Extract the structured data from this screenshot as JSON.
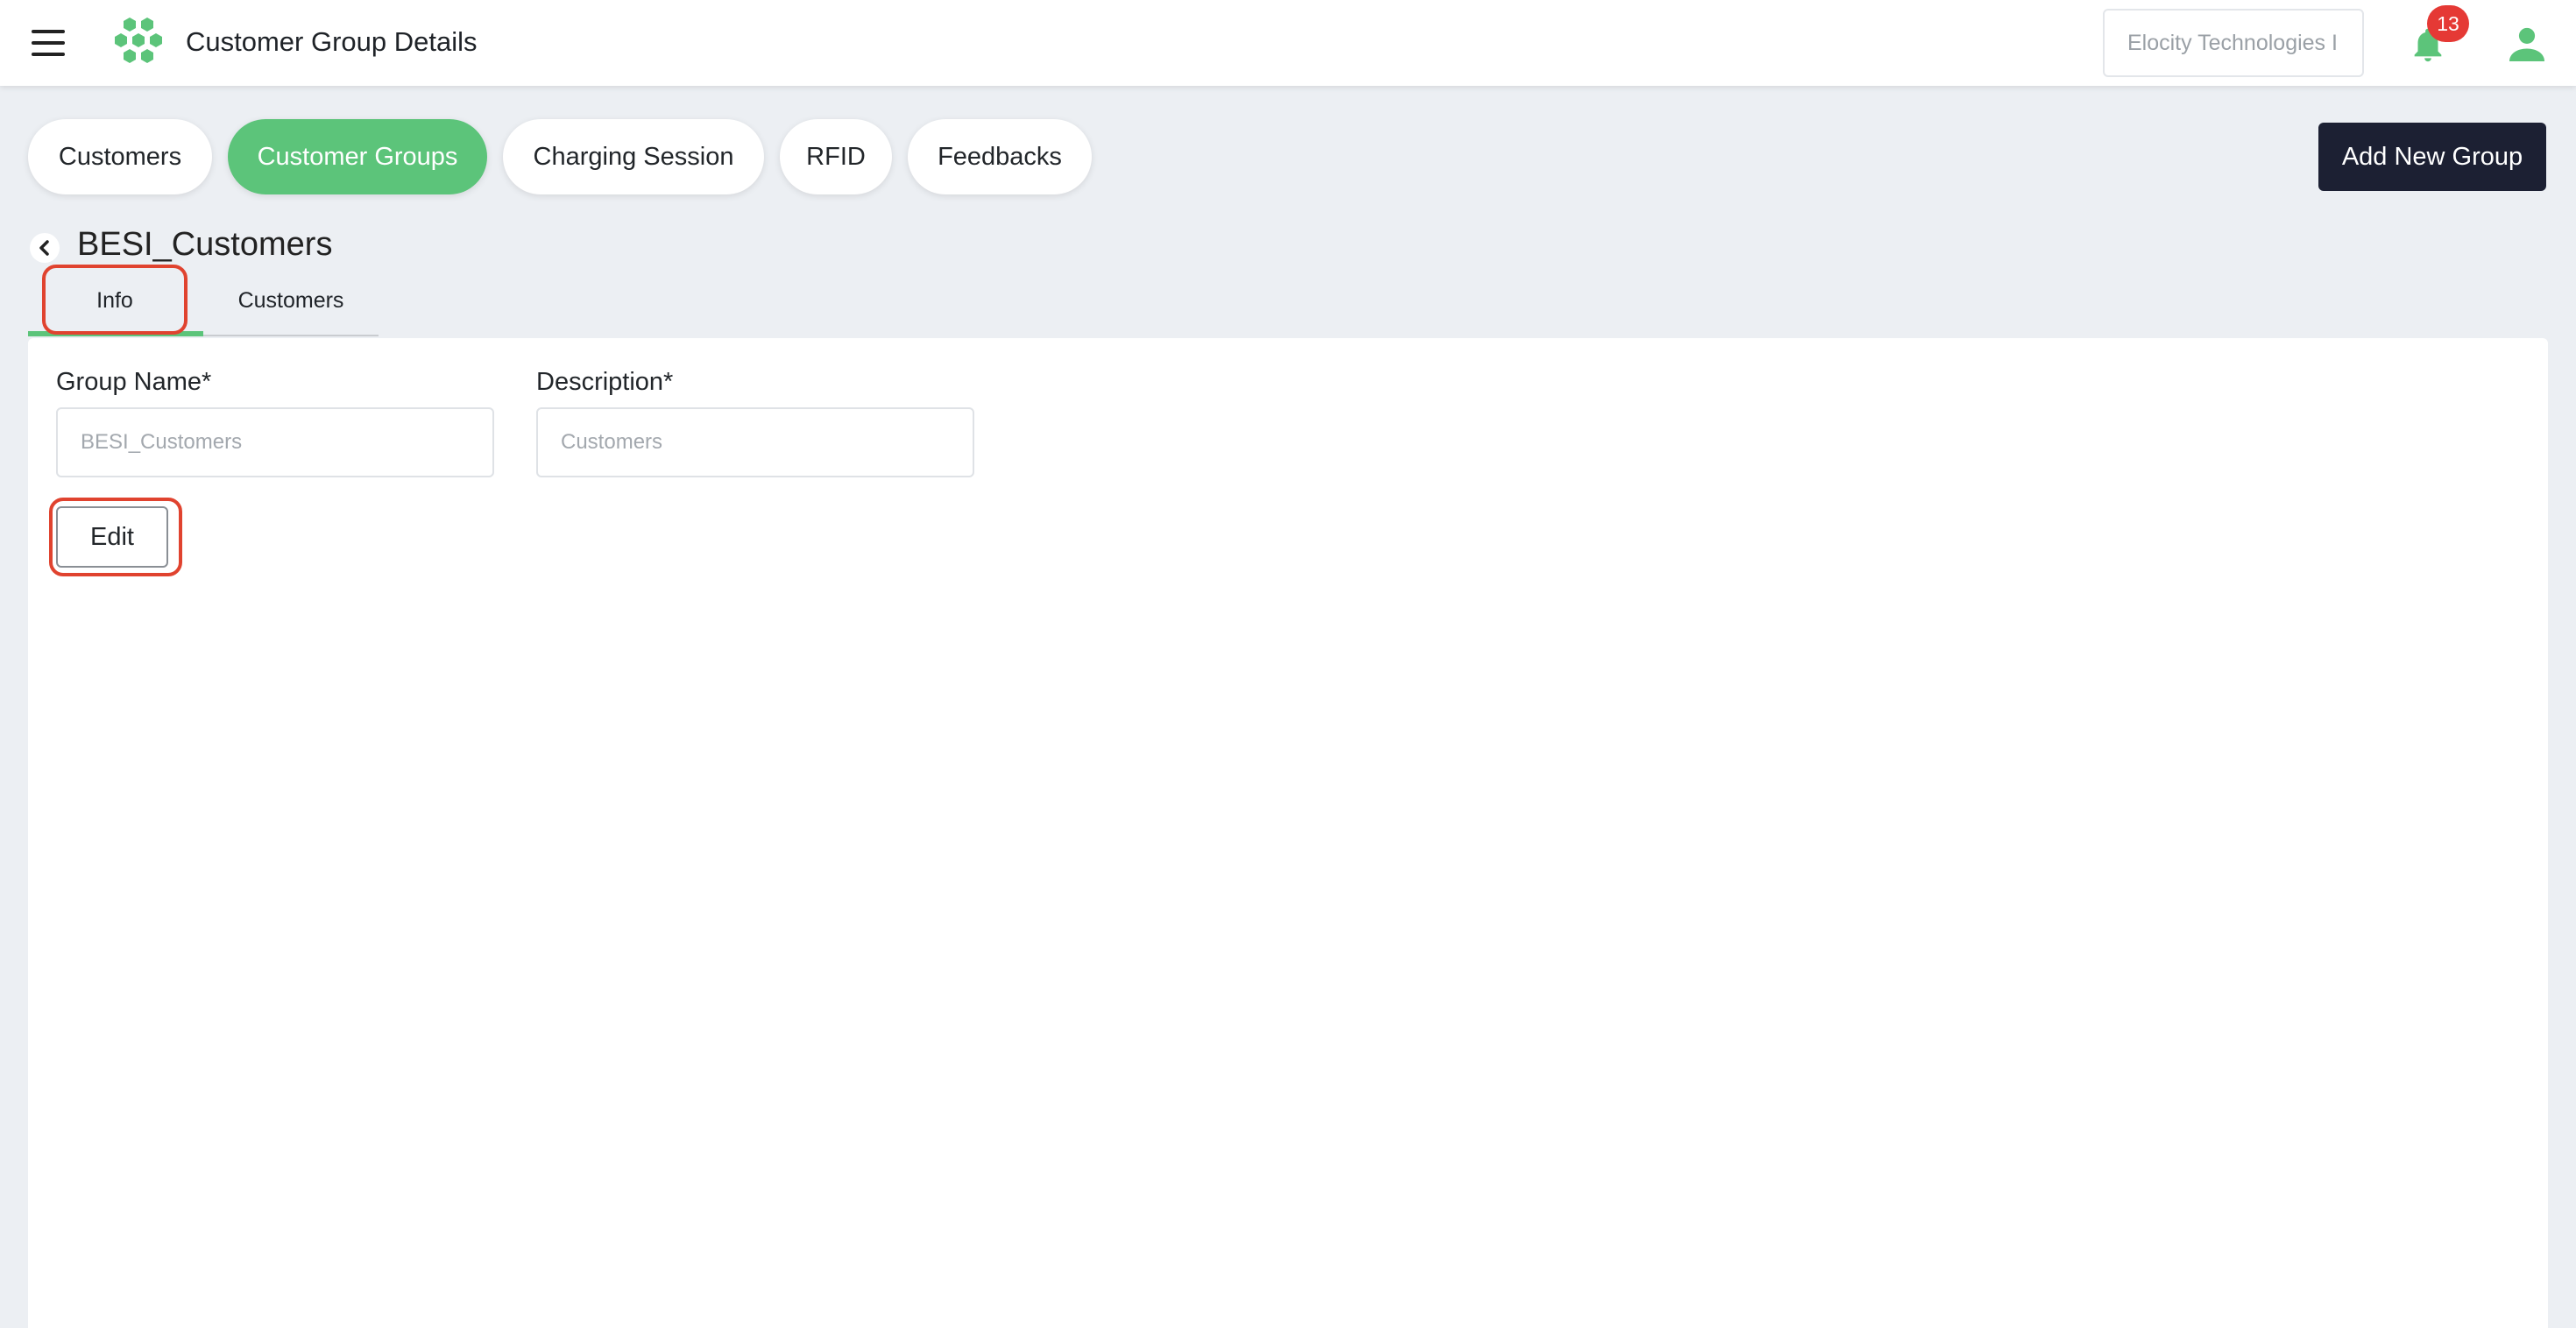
{
  "header": {
    "title": "Customer Group Details",
    "org_selector": "Elocity Technologies I",
    "notification_count": "13",
    "brand_color": "#5cc47a"
  },
  "nav_tabs": [
    {
      "label": "Customers",
      "active": false
    },
    {
      "label": "Customer Groups",
      "active": true
    },
    {
      "label": "Charging Session",
      "active": false
    },
    {
      "label": "RFID",
      "active": false
    },
    {
      "label": "Feedbacks",
      "active": false
    }
  ],
  "actions": {
    "add_group_label": "Add New Group"
  },
  "group": {
    "name": "BESI_Customers"
  },
  "sub_tabs": [
    {
      "label": "Info",
      "active": true
    },
    {
      "label": "Customers",
      "active": false
    }
  ],
  "form": {
    "group_name_label": "Group Name*",
    "group_name_placeholder": "BESI_Customers",
    "description_label": "Description*",
    "description_placeholder": "Customers",
    "edit_label": "Edit"
  },
  "icons": {
    "menu": "hamburger-menu-icon",
    "logo": "hexagon-cluster-logo",
    "notifications": "bell-icon",
    "user": "user-icon",
    "back": "chevron-left-icon"
  }
}
